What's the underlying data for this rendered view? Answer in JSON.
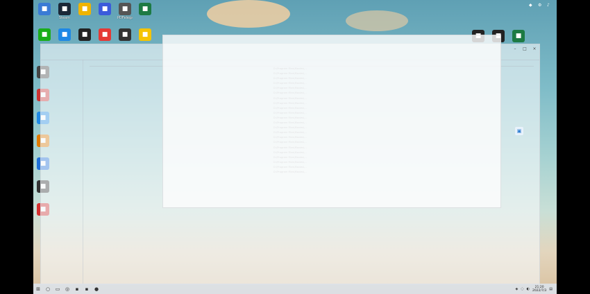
{
  "desktop": {
    "top_icons": [
      {
        "label": "",
        "icon": "monitor-icon",
        "color": "#3a7bd5"
      },
      {
        "label": "Steam",
        "icon": "steam-icon",
        "color": "#1b2838"
      },
      {
        "label": "",
        "icon": "media-icon",
        "color": "#f0b400"
      },
      {
        "label": "",
        "icon": "video-app-icon",
        "color": "#3b5bdb"
      },
      {
        "label": "PDFelegant",
        "icon": "pdf-app-icon",
        "color": "#555"
      },
      {
        "label": "",
        "icon": "excel-icon",
        "color": "#1d7a43"
      }
    ],
    "second_row_icons": [
      {
        "label": "",
        "icon": "chat-icon",
        "color": "#1aad19"
      },
      {
        "label": "",
        "icon": "browser-icon",
        "color": "#1e88e5"
      },
      {
        "label": "",
        "icon": "panda-icon",
        "color": "#222"
      },
      {
        "label": "",
        "icon": "record-icon",
        "color": "#e53935"
      },
      {
        "label": "",
        "icon": "app-icon",
        "color": "#333"
      },
      {
        "label": "",
        "icon": "search-app-icon",
        "color": "#f5c400"
      }
    ],
    "left_icons": [
      {
        "label": "",
        "icon": "app-icon",
        "color": "#444"
      },
      {
        "label": "",
        "icon": "app-icon",
        "color": "#c33"
      },
      {
        "label": "",
        "icon": "app-icon",
        "color": "#1e88e5"
      },
      {
        "label": "",
        "icon": "app-icon",
        "color": "#e07a00"
      },
      {
        "label": "",
        "icon": "app-icon",
        "color": "#1e6fd9"
      },
      {
        "label": "",
        "icon": "app-icon",
        "color": "#333"
      },
      {
        "label": "",
        "icon": "app-icon",
        "color": "#d32f2f"
      }
    ],
    "right_icons": [
      {
        "label": "",
        "icon": "app-icon",
        "color": "#222"
      },
      {
        "label": "",
        "icon": "app-icon",
        "color": "#222"
      },
      {
        "label": "",
        "icon": "excel-icon",
        "color": "#1d7a43"
      }
    ]
  },
  "window": {
    "title": "",
    "tabs": [
      "",
      "",
      "",
      "",
      "",
      "",
      "",
      "",
      ""
    ],
    "sidebar_items": [
      "",
      "",
      "",
      "",
      "",
      "",
      "",
      "",
      "",
      "",
      "",
      ""
    ],
    "columns": [
      "",
      "",
      "",
      ""
    ],
    "rows": [
      {
        "name": "",
        "path": "D:\\Program Files\\Movies\\...",
        "size": "",
        "date": ""
      },
      {
        "name": "",
        "path": "D:\\Program Files\\Movies\\...",
        "size": "",
        "date": ""
      },
      {
        "name": "",
        "path": "D:\\Program Files\\Movies\\...",
        "size": "",
        "date": ""
      },
      {
        "name": "",
        "path": "D:\\Program Files\\Movies\\...",
        "size": "",
        "date": ""
      },
      {
        "name": "",
        "path": "D:\\Program Files\\Movies\\...",
        "size": "",
        "date": ""
      },
      {
        "name": "",
        "path": "D:\\Program Files\\Movies\\...",
        "size": "",
        "date": ""
      },
      {
        "name": "",
        "path": "D:\\Program Files\\Movies\\...",
        "size": "",
        "date": ""
      },
      {
        "name": "",
        "path": "D:\\Program Files\\Movies\\...",
        "size": "",
        "date": ""
      },
      {
        "name": "",
        "path": "D:\\Program Files\\Movies\\...",
        "size": "",
        "date": ""
      },
      {
        "name": "",
        "path": "D:\\Program Files\\Movies\\...",
        "size": "",
        "date": ""
      },
      {
        "name": "",
        "path": "D:\\Program Files\\Movies\\...",
        "size": "",
        "date": ""
      },
      {
        "name": "",
        "path": "D:\\Program Files\\Movies\\...",
        "size": "",
        "date": ""
      },
      {
        "name": "",
        "path": "D:\\Program Files\\Movies\\...",
        "size": "",
        "date": ""
      },
      {
        "name": "",
        "path": "D:\\Program Files\\Movies\\...",
        "size": "",
        "date": ""
      },
      {
        "name": "",
        "path": "D:\\Program Files\\Movies\\...",
        "size": "",
        "date": ""
      },
      {
        "name": "",
        "path": "D:\\Program Files\\Movies\\...",
        "size": "",
        "date": ""
      },
      {
        "name": "",
        "path": "D:\\Program Files\\Movies\\...",
        "size": "",
        "date": ""
      },
      {
        "name": "",
        "path": "D:\\Program Files\\Movies\\...",
        "size": "",
        "date": ""
      },
      {
        "name": "",
        "path": "D:\\Program Files\\Movies\\...",
        "size": "",
        "date": ""
      },
      {
        "name": "",
        "path": "D:\\Program Files\\Movies\\...",
        "size": "",
        "date": ""
      },
      {
        "name": "",
        "path": "D:\\Program Files\\Movies\\...",
        "size": "",
        "date": ""
      },
      {
        "name": "",
        "path": "D:\\Program Files\\Movies\\...",
        "size": "",
        "date": ""
      }
    ]
  },
  "overlay_window": {
    "title": ""
  },
  "taskbar": {
    "time": "21:20",
    "date": "2022/7/3"
  }
}
